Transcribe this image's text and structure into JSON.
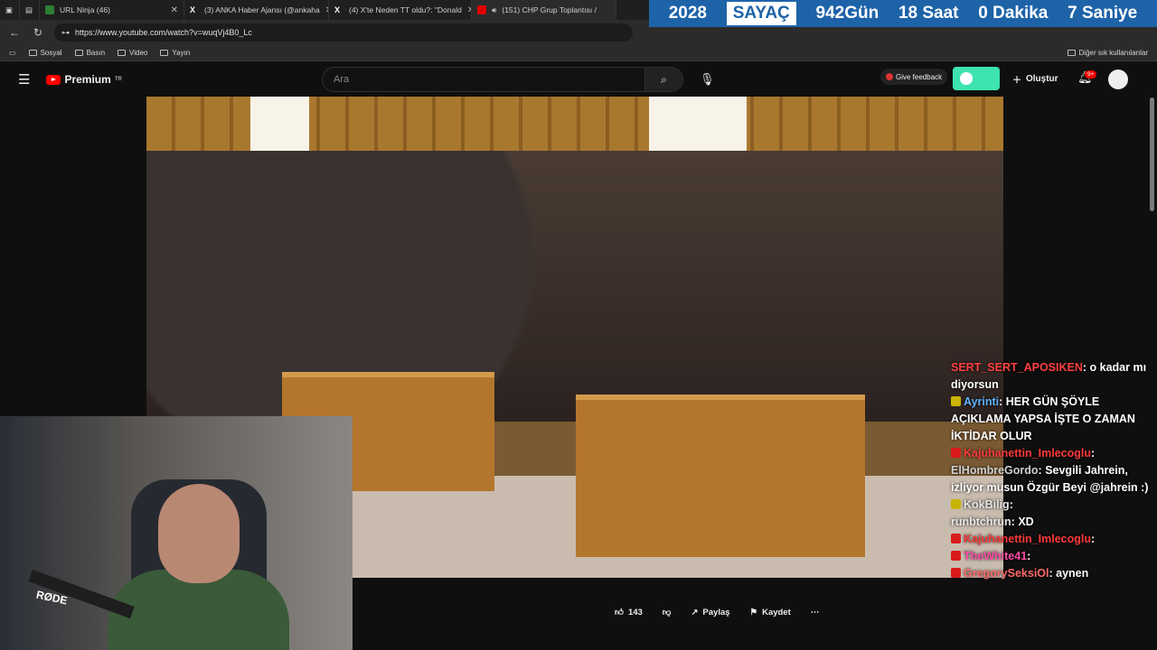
{
  "tabs": [
    {
      "label": "URL Ninja (46)",
      "favicon_color": "#2e7d32"
    },
    {
      "label": "(3) ANKA Haber Ajansı (@ankaha",
      "favicon_color": "#111111"
    },
    {
      "label": "(4) X'te Neden TT oldu?: \"Donald",
      "favicon_color": "#111111"
    },
    {
      "label": "(151) CHP Grup Toplantısı /",
      "favicon_color": "#e00000"
    }
  ],
  "counter": {
    "year": "2028",
    "label": "SAYAÇ",
    "days": "942",
    "days_unit": "Gün",
    "hours": "18",
    "hours_unit": "Saat",
    "minutes": "0",
    "minutes_unit": "Dakika",
    "seconds": "7",
    "seconds_unit": "Saniye"
  },
  "address": {
    "url": "https://www.youtube.com/watch?v=wuqVj4B0_Lc"
  },
  "bookmarks": {
    "items": [
      "Sosyal",
      "Basın",
      "Video",
      "Yayın"
    ],
    "right": "Diğer sık kullanılanlar"
  },
  "youtube": {
    "logo_text": "Premium",
    "logo_region": "TR",
    "search_placeholder": "Ara",
    "feedback": "Give feedback",
    "create": "Oluştur",
    "notifications": "9+"
  },
  "actions": {
    "likes": "143",
    "share": "Paylaş",
    "save": "Kaydet",
    "more": "⋯"
  },
  "chat": [
    {
      "user": "SERT_SERT_APOSIKEN",
      "text": "o kadar mı diyorsun",
      "user_color": "#ff4040",
      "badge_color": ""
    },
    {
      "user": "Ayrinti",
      "text": "HER GÜN ŞÖYLE AÇIKLAMA YAPSA İŞTE O ZAMAN İKTİDAR OLUR",
      "user_color": "#5fb3ff",
      "badge_color": "#c8b400"
    },
    {
      "user": "Kajuhanettin_Imlecoglu",
      "text": "",
      "user_color": "#ff3b3b",
      "badge_color": "#d81b1b"
    },
    {
      "user": "ElHombreGordo",
      "text": "Sevgili Jahrein, izliyor musun Özgür Beyi @jahrein :)",
      "user_color": "#d0d0d0",
      "badge_color": ""
    },
    {
      "user": "KokBilig",
      "text": "",
      "user_color": "#e6e6e6",
      "badge_color": "#c8b400"
    },
    {
      "user": "runbtchrun",
      "text": "XD",
      "user_color": "#e6e6e6",
      "badge_color": ""
    },
    {
      "user": "Kajuhanettin_Imlecoglu",
      "text": "",
      "user_color": "#ff3b3b",
      "badge_color": "#d81b1b"
    },
    {
      "user": "TheWhite41",
      "text": "",
      "user_color": "#ff4da6",
      "badge_color": "#d81b1b"
    },
    {
      "user": "GregorySeksiOl",
      "text": "aynen",
      "user_color": "#ff6b6b",
      "badge_color": "#d81b1b"
    }
  ],
  "webcam": {
    "mic_brand": "RØDE"
  }
}
